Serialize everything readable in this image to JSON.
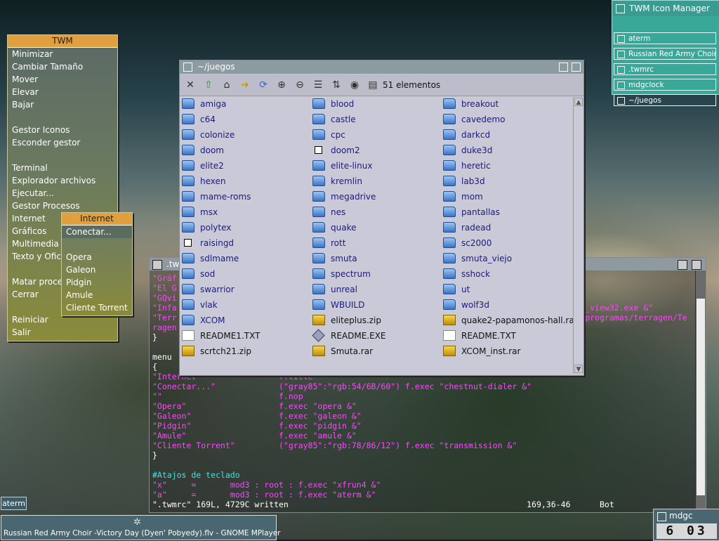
{
  "twm_menu": {
    "title": "TWM",
    "items": [
      "Minimizar",
      "Cambiar Tamaño",
      "Mover",
      "Elevar",
      "Bajar",
      "",
      "Gestor Iconos",
      "Esconder gestor",
      "",
      "Terminal",
      "Explorador archivos",
      "Ejecutar...",
      "Gestor Procesos",
      "Internet",
      "Gráficos",
      "Multimedia",
      "Texto y Ofic",
      "",
      "Matar proce",
      "Cerrar",
      "",
      "Reiniciar",
      "Salir"
    ]
  },
  "internet_menu": {
    "title": "Internet",
    "items": [
      "Conectar...",
      "",
      "Opera",
      "Galeon",
      "Pidgin",
      "Amule",
      "Cliente Torrent"
    ]
  },
  "file_manager": {
    "title": "~/juegos",
    "count_label": "51 elementos",
    "columns": [
      [
        {
          "name": "amiga",
          "type": "folder"
        },
        {
          "name": "c64",
          "type": "folder"
        },
        {
          "name": "colonize",
          "type": "folder"
        },
        {
          "name": "doom",
          "type": "folder"
        },
        {
          "name": "elite2",
          "type": "folder"
        },
        {
          "name": "hexen",
          "type": "folder"
        },
        {
          "name": "mame-roms",
          "type": "folder"
        },
        {
          "name": "msx",
          "type": "folder"
        },
        {
          "name": "polytex",
          "type": "folder"
        },
        {
          "name": "raisingd",
          "type": "link"
        },
        {
          "name": "sdlmame",
          "type": "folder"
        },
        {
          "name": "sod",
          "type": "folder"
        },
        {
          "name": "swarrior",
          "type": "folder"
        },
        {
          "name": "vlak",
          "type": "folder"
        },
        {
          "name": "XCOM",
          "type": "folder"
        },
        {
          "name": "README1.TXT",
          "type": "txt"
        },
        {
          "name": "scrtch21.zip",
          "type": "zip"
        }
      ],
      [
        {
          "name": "blood",
          "type": "folder"
        },
        {
          "name": "castle",
          "type": "folder"
        },
        {
          "name": "cpc",
          "type": "folder"
        },
        {
          "name": "doom2",
          "type": "link"
        },
        {
          "name": "elite-linux",
          "type": "folder"
        },
        {
          "name": "kremlin",
          "type": "folder"
        },
        {
          "name": "megadrive",
          "type": "folder"
        },
        {
          "name": "nes",
          "type": "folder"
        },
        {
          "name": "quake",
          "type": "folder"
        },
        {
          "name": "rott",
          "type": "folder"
        },
        {
          "name": "smuta",
          "type": "folder"
        },
        {
          "name": "spectrum",
          "type": "folder"
        },
        {
          "name": "unreal",
          "type": "folder"
        },
        {
          "name": "WBUILD",
          "type": "folder"
        },
        {
          "name": "eliteplus.zip",
          "type": "zip"
        },
        {
          "name": "README.EXE",
          "type": "exe"
        },
        {
          "name": "Smuta.rar",
          "type": "zip"
        }
      ],
      [
        {
          "name": "breakout",
          "type": "folder"
        },
        {
          "name": "cavedemo",
          "type": "folder"
        },
        {
          "name": "darkcd",
          "type": "folder"
        },
        {
          "name": "duke3d",
          "type": "folder"
        },
        {
          "name": "heretic",
          "type": "folder"
        },
        {
          "name": "lab3d",
          "type": "folder"
        },
        {
          "name": "mom",
          "type": "folder"
        },
        {
          "name": "pantallas",
          "type": "folder"
        },
        {
          "name": "radead",
          "type": "folder"
        },
        {
          "name": "sc2000",
          "type": "folder"
        },
        {
          "name": "smuta_viejo",
          "type": "folder"
        },
        {
          "name": "sshock",
          "type": "folder"
        },
        {
          "name": "ut",
          "type": "folder"
        },
        {
          "name": "wolf3d",
          "type": "folder"
        },
        {
          "name": "quake2-papamonos-hall.rar",
          "type": "zip"
        },
        {
          "name": "README.TXT",
          "type": "txt"
        },
        {
          "name": "XCOM_inst.rar",
          "type": "zip"
        }
      ]
    ]
  },
  "terminal": {
    "title": ".tw",
    "lines": [
      {
        "text": "\"Gráf",
        "cls": "mag"
      },
      {
        "text": "\"El G",
        "cls": "mag"
      },
      {
        "text": "\"GQvi",
        "cls": "mag"
      },
      {
        "text": "\"Infa                                                                                    _view32.exe &\"",
        "cls": "mag"
      },
      {
        "text": "\"Terr                                                                                   /programas/terragen/Te",
        "cls": "mag"
      },
      {
        "text": "ragen",
        "cls": "mag"
      },
      {
        "text": "}",
        "cls": "wh"
      },
      {
        "text": "",
        "cls": "wh"
      },
      {
        "text": "menu",
        "cls": "wh"
      },
      {
        "text": "{",
        "cls": "wh"
      },
      {
        "text": "\"Internet\"                f.title",
        "cls": "mag"
      },
      {
        "text": "\"Conectar...\"             (\"gray85\":\"rgb:54/6B/60\") f.exec \"chestnut-dialer &\"",
        "cls": "mag"
      },
      {
        "text": "\"\"                        f.nop",
        "cls": "mag"
      },
      {
        "text": "\"Opera\"                   f.exec \"opera &\"",
        "cls": "mag"
      },
      {
        "text": "\"Galeon\"                  f.exec \"galeon &\"",
        "cls": "mag"
      },
      {
        "text": "\"Pidgin\"                  f.exec \"pidgin &\"",
        "cls": "mag"
      },
      {
        "text": "\"Amule\"                   f.exec \"amule &\"",
        "cls": "mag"
      },
      {
        "text": "\"Cliente Torrent\"         (\"gray85\":\"rgb:78/86/12\") f.exec \"transmission &\"",
        "cls": "mag"
      },
      {
        "text": "}",
        "cls": "wh"
      },
      {
        "text": "",
        "cls": "wh"
      },
      {
        "text": "#Atajos de teclado",
        "cls": "cy"
      },
      {
        "text": "\"x\"     =       mod3 : root : f.exec \"xfrun4 &\"",
        "cls": "mag"
      },
      {
        "text": "\"a\"     =       mod3 : root : f.exec \"aterm &\"",
        "cls": "mag"
      },
      {
        "text": "\".twmrc\" 169L, 4729C written                                                 169,36-46      Bot",
        "cls": "wh"
      }
    ]
  },
  "icon_manager": {
    "title": "TWM Icon Manager",
    "items": [
      "aterm",
      "Russian Red Army Choir",
      ".twmrc",
      "mdgclock",
      "~/juegos"
    ]
  },
  "aterm_icon": {
    "label": "aterm"
  },
  "mplayer": {
    "label": "Russian Red Army Choir -Victory Day (Dyen' Pobyedy).flv - GNOME MPlayer"
  },
  "clock": {
    "title": "mdgc",
    "time": "6 03"
  }
}
